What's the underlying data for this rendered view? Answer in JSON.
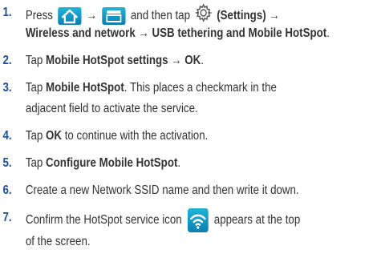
{
  "steps": [
    {
      "number": "1.",
      "line1_prefix": "Press",
      "arrow1": "→",
      "line1_mid": "and then tap",
      "settings_label": "(Settings)",
      "arrow2": "→",
      "line2": "Wireless and network → USB tethering and Mobile HotSpot",
      "line2_end": "."
    },
    {
      "number": "2.",
      "prefix": "Tap",
      "bold": "Mobile HotSpot settings → OK",
      "suffix": "."
    },
    {
      "number": "3.",
      "prefix": "Tap",
      "bold": "Mobile HotSpot",
      "suffix": ". This places a checkmark in the",
      "line2": "adjacent field to activate the service."
    },
    {
      "number": "4.",
      "prefix": "Tap",
      "bold": "OK",
      "suffix": "to continue with the activation."
    },
    {
      "number": "5.",
      "prefix": "Tap",
      "bold": "Configure Mobile HotSpot",
      "suffix": "."
    },
    {
      "number": "6.",
      "text": "Create a new Network SSID name and then write it down."
    },
    {
      "number": "7.",
      "prefix": "Confirm the HotSpot service icon",
      "suffix": "appears at the top",
      "line2": "of the screen."
    }
  ],
  "icons": {
    "home": "home-icon",
    "menu": "menu-icon",
    "settings": "gear-icon",
    "hotspot": "wifi-hotspot-icon"
  },
  "colors": {
    "step_number": "#1a4f9c",
    "icon_bg": "#1496c4"
  }
}
